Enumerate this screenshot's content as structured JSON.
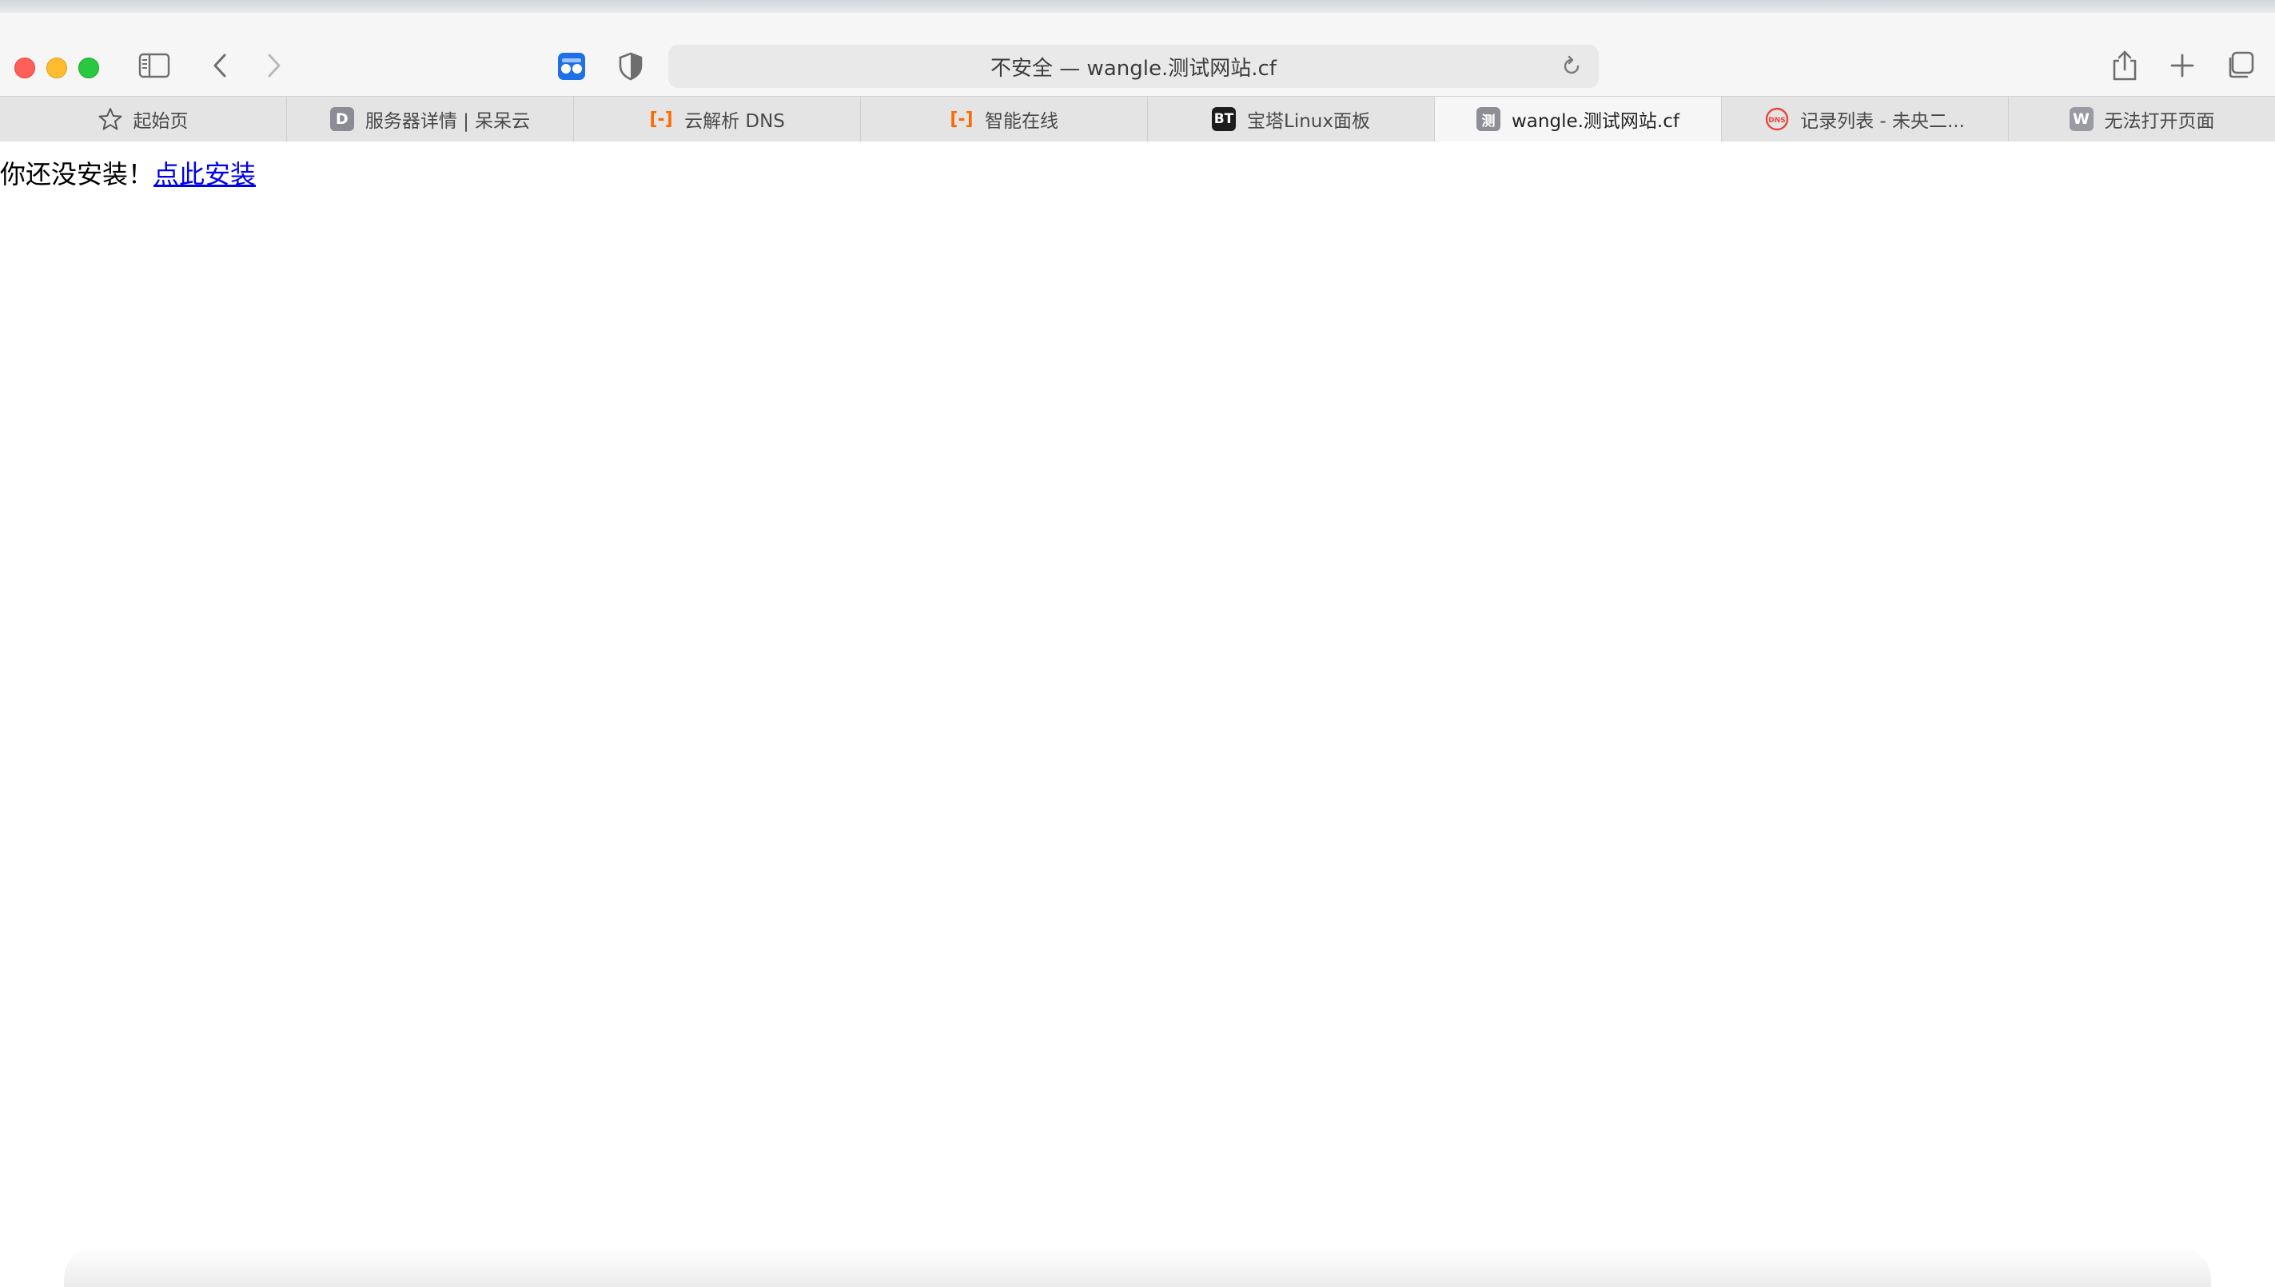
{
  "browser": {
    "address_text": "不安全 — wangle.测试网站.cf"
  },
  "tabs": [
    {
      "label": "起始页",
      "icon": "star-icon"
    },
    {
      "label": "服务器详情 | 呆呆云",
      "favicon_text": "D"
    },
    {
      "label": "云解析 DNS",
      "favicon_text": "[-]"
    },
    {
      "label": "智能在线",
      "favicon_text": "[-]"
    },
    {
      "label": "宝塔Linux面板",
      "favicon_text": "BT"
    },
    {
      "label": "wangle.测试网站.cf",
      "favicon_text": "测",
      "active": true
    },
    {
      "label": "记录列表 - 未央二...",
      "favicon_text": "DNS"
    },
    {
      "label": "无法打开页面",
      "favicon_text": "W"
    }
  ],
  "page": {
    "message": "你还没安装！",
    "link_text": "点此安装"
  },
  "colors": {
    "close": "#fe5f57",
    "minimize": "#febc2e",
    "zoom": "#28c840",
    "link": "#0000ee",
    "aliyun_orange": "#ff6a00"
  }
}
